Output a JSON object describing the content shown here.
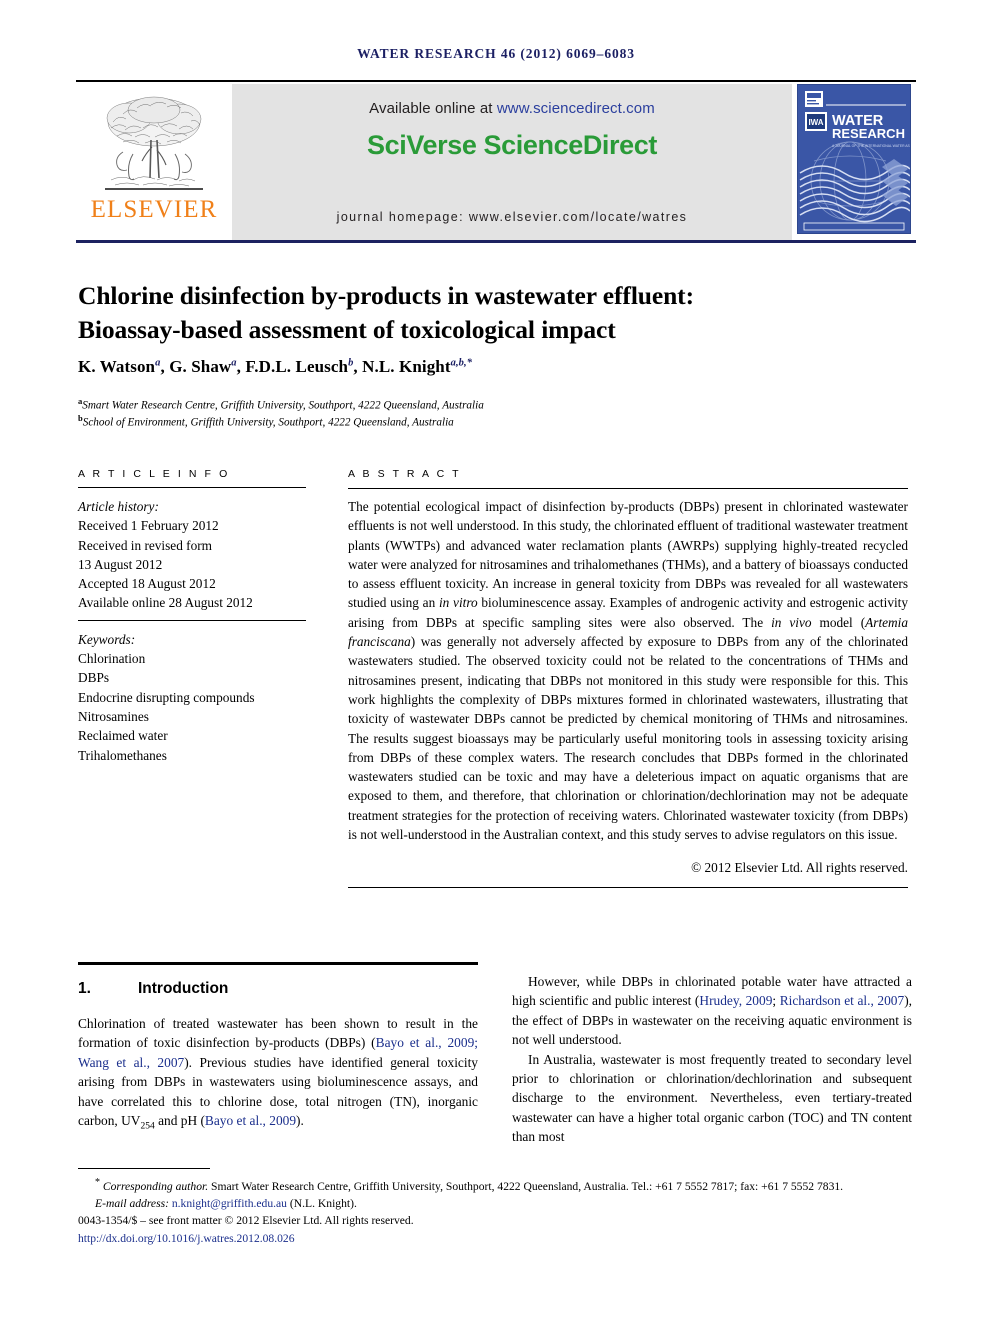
{
  "running_head": "WATER RESEARCH 46 (2012) 6069–6083",
  "masthead": {
    "available_prefix": "Available online at ",
    "available_url": "www.sciencedirect.com",
    "brand_sci": "SciVerse ",
    "brand_direct": "ScienceDirect",
    "homepage": "journal homepage: www.elsevier.com/locate/watres",
    "publisher_name": "ELSEVIER",
    "cover_title_line1": "WATER",
    "cover_title_line2": "RESEARCH",
    "cover_subtitle": "A JOURNAL OF THE INTERNATIONAL WATER ASSOCIATION",
    "cover_logo_text": "IWA",
    "colors": {
      "running_head": "#1b1f63",
      "sciencedirect_green": "#2a9b38",
      "link_blue": "#2b3f9e",
      "elsevier_orange": "#f08019",
      "cover_blue": "#3a56a6",
      "panel_grey": "#e3e3e3",
      "reference_blue": "#1b2f8c"
    }
  },
  "article": {
    "title_line1": "Chlorine disinfection by-products in wastewater effluent:",
    "title_line2": "Bioassay-based assessment of toxicological impact",
    "authors": [
      {
        "name": "K. Watson",
        "sup": "a"
      },
      {
        "name": "G. Shaw",
        "sup": "a"
      },
      {
        "name": "F.D.L. Leusch",
        "sup": "b"
      },
      {
        "name": "N.L. Knight",
        "sup": "a,b,*"
      }
    ],
    "affiliations": [
      {
        "marker": "a",
        "text": "Smart Water Research Centre, Griffith University, Southport, 4222 Queensland, Australia"
      },
      {
        "marker": "b",
        "text": "School of Environment, Griffith University, Southport, 4222 Queensland, Australia"
      }
    ]
  },
  "article_info": {
    "label": "A R T I C L E  I N F O",
    "history_heading": "Article history:",
    "history": [
      "Received 1 February 2012",
      "Received in revised form",
      "13 August 2012",
      "Accepted 18 August 2012",
      "Available online 28 August 2012"
    ],
    "keywords_heading": "Keywords:",
    "keywords": [
      "Chlorination",
      "DBPs",
      "Endocrine disrupting compounds",
      "Nitrosamines",
      "Reclaimed water",
      "Trihalomethanes"
    ]
  },
  "abstract": {
    "label": "A B S T R A C T",
    "paragraphs": [
      "The potential ecological impact of disinfection by-products (DBPs) present in chlorinated wastewater effluents is not well understood. In this study, the chlorinated effluent of traditional wastewater treatment plants (WWTPs) and advanced water reclamation plants (AWRPs) supplying highly-treated recycled water were analyzed for nitrosamines and trihalomethanes (THMs), and a battery of bioassays conducted to assess effluent toxicity. An increase in general toxicity from DBPs was revealed for all wastewaters studied using an in vitro bioluminescence assay. Examples of androgenic activity and estrogenic activity arising from DBPs at specific sampling sites were also observed. The in vivo model (Artemia franciscana) was generally not adversely affected by exposure to DBPs from any of the chlorinated wastewaters studied. The observed toxicity could not be related to the concentrations of THMs and nitrosamines present, indicating that DBPs not monitored in this study were responsible for this. This work highlights the complexity of DBPs mixtures formed in chlorinated wastewaters, illustrating that toxicity of wastewater DBPs cannot be predicted by chemical monitoring of THMs and nitrosamines. The results suggest bioassays may be particularly useful monitoring tools in assessing toxicity arising from DBPs of these complex waters. The research concludes that DBPs formed in the chlorinated wastewaters studied can be toxic and may have a deleterious impact on aquatic organisms that are exposed to them, and therefore, that chlorination or chlorination/dechlorination may not be adequate treatment strategies for the protection of receiving waters. Chlorinated wastewater toxicity (from DBPs) is not well-understood in the Australian context, and this study serves to advise regulators on this issue."
    ],
    "copyright": "© 2012 Elsevier Ltd. All rights reserved."
  },
  "introduction": {
    "number": "1.",
    "heading": "Introduction",
    "left_paragraph_parts": [
      {
        "t": "Chlorination of treated wastewater has been shown to result in the formation of toxic disinfection by-products (DBPs) (",
        "link": false
      },
      {
        "t": "Bayo et al., 2009; Wang et al., 2007",
        "link": true
      },
      {
        "t": "). Previous studies have identified general toxicity arising from DBPs in wastewaters using bioluminescence assays, and have correlated this to chlorine dose, total nitrogen (TN), inorganic carbon, UV",
        "link": false
      },
      {
        "t": "254",
        "link": false,
        "sub": true
      },
      {
        "t": " and pH (",
        "link": false
      },
      {
        "t": "Bayo et al., 2009",
        "link": true
      },
      {
        "t": ").",
        "link": false
      }
    ],
    "right_paragraph_1_parts": [
      {
        "t": "However, while DBPs in chlorinated potable water have attracted a high scientific and public interest (",
        "link": false
      },
      {
        "t": "Hrudey, 2009",
        "link": true
      },
      {
        "t": "; ",
        "link": false
      },
      {
        "t": "Richardson et al., 2007",
        "link": true
      },
      {
        "t": "), the effect of DBPs in wastewater on the receiving aquatic environment is not well understood.",
        "link": false
      }
    ],
    "right_paragraph_2": "In Australia, wastewater is most frequently treated to secondary level prior to chlorination or chlorination/dechlorination and subsequent discharge to the environment. Nevertheless, even tertiary-treated wastewater can have a higher total organic carbon (TOC) and TN content than most"
  },
  "footer": {
    "corresponding_marker": "*",
    "corresponding_label": "Corresponding author.",
    "corresponding_text": " Smart Water Research Centre, Griffith University, Southport, 4222 Queensland, Australia. Tel.: +61 7 5552 7817; fax: +61 7 5552 7831.",
    "email_label": "E-mail address: ",
    "email": "n.knight@griffith.edu.au",
    "email_suffix": " (N.L. Knight).",
    "issn_line": "0043-1354/$ – see front matter © 2012 Elsevier Ltd. All rights reserved.",
    "doi": "http://dx.doi.org/10.1016/j.watres.2012.08.026"
  }
}
